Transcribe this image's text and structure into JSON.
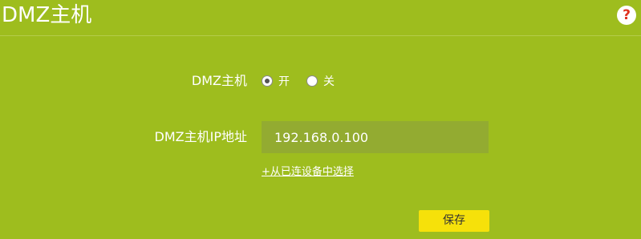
{
  "header": {
    "title": "DMZ主机",
    "help_icon": "question-icon",
    "help_glyph": "?"
  },
  "form": {
    "dmz_label": "DMZ主机",
    "dmz_options": [
      {
        "label": "开",
        "selected": true
      },
      {
        "label": "关",
        "selected": false
      }
    ],
    "ip_label": "DMZ主机IP地址",
    "ip_value": "192.168.0.100",
    "select_device_link": "+从已连设备中选择",
    "save_label": "保存"
  },
  "colors": {
    "background": "#9ebd1e",
    "input_background": "#93ab31",
    "save_button": "#f6e10a",
    "help_icon": "#e0311f"
  }
}
